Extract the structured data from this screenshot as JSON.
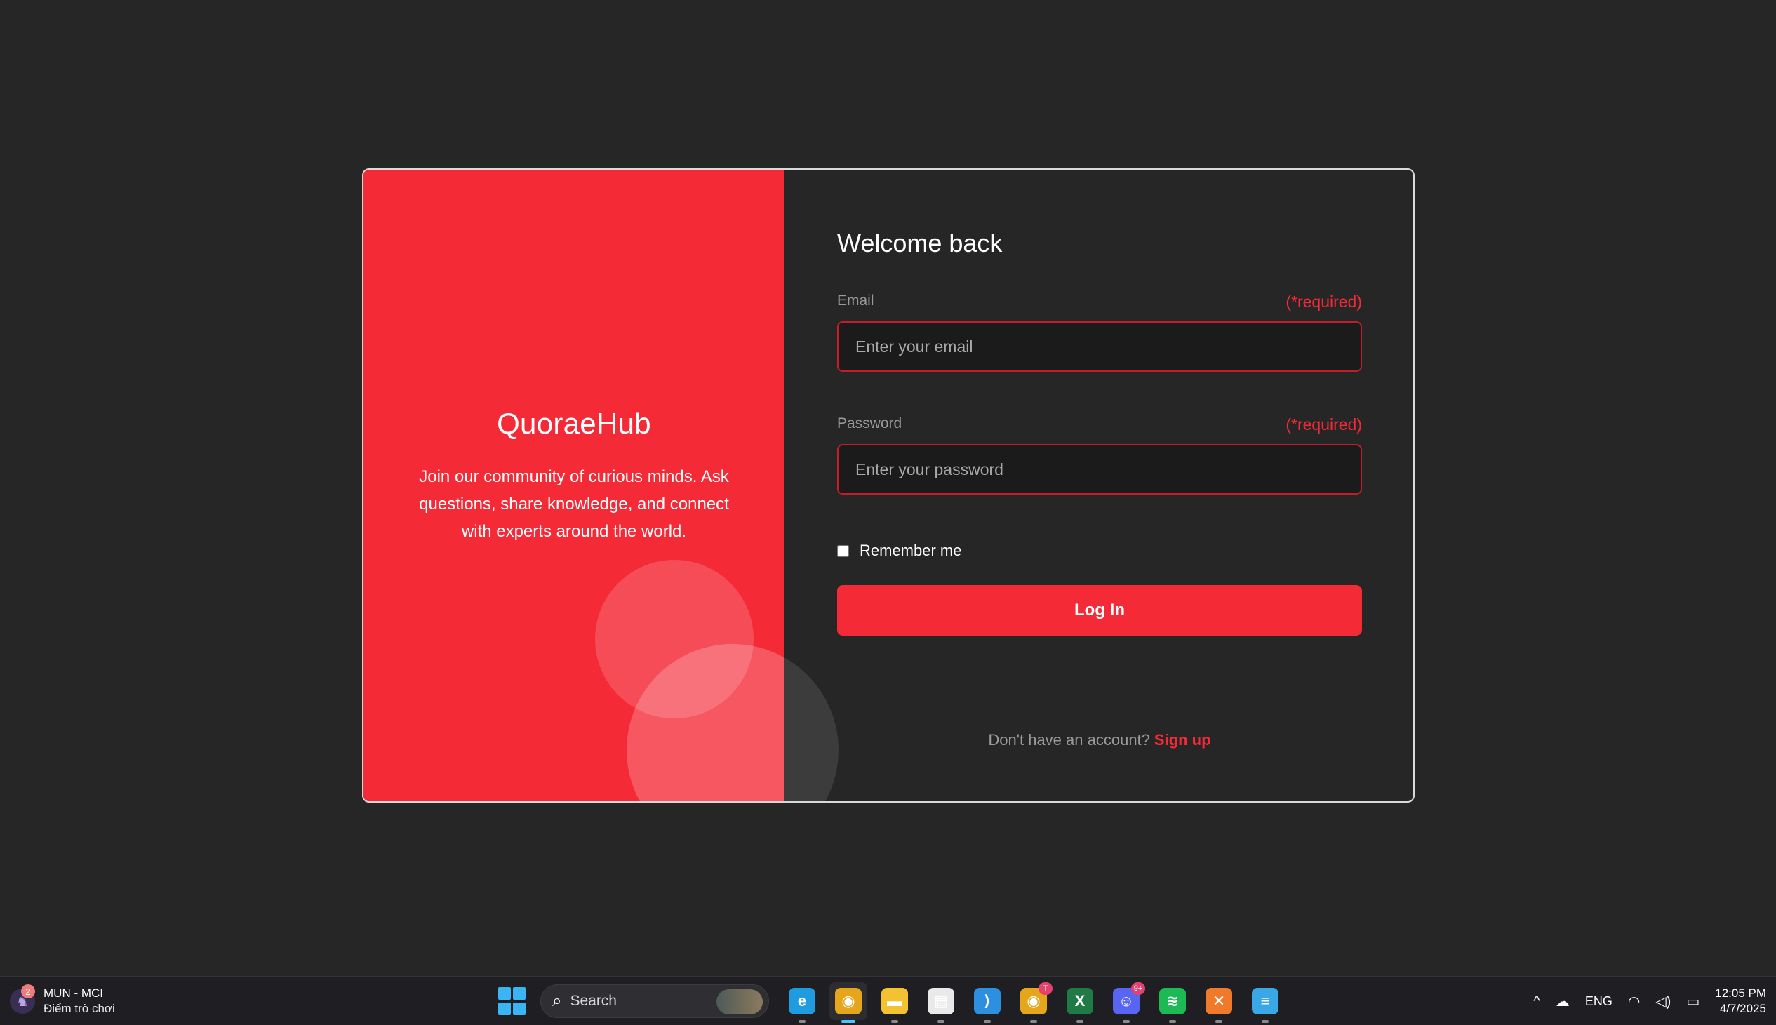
{
  "brand": {
    "title": "QuoraeHub",
    "description": "Join our community of curious minds. Ask questions, share knowledge, and connect with experts around the world.",
    "accent_color": "#f42a37"
  },
  "form": {
    "heading": "Welcome back",
    "email": {
      "label": "Email",
      "required_text": "(*required)",
      "placeholder": "Enter your email",
      "value": ""
    },
    "password": {
      "label": "Password",
      "required_text": "(*required)",
      "placeholder": "Enter your password",
      "value": ""
    },
    "remember_label": "Remember me",
    "remember_checked": false,
    "login_label": "Log In",
    "signup_prompt": "Don't have an account?",
    "signup_link": "Sign up"
  },
  "taskbar": {
    "game": {
      "badge": "2",
      "title": "MUN - MCI",
      "subtitle": "Điểm trò chơi"
    },
    "search_label": "Search",
    "apps": [
      {
        "name": "edge-icon",
        "label": "e",
        "color": "#1f9be0"
      },
      {
        "name": "chrome-icon",
        "label": "◉",
        "color": "#e5a61b",
        "active": true
      },
      {
        "name": "file-explorer-icon",
        "label": "▬",
        "color": "#f2c230"
      },
      {
        "name": "store-icon",
        "label": "▦",
        "color": "#e9e9e9"
      },
      {
        "name": "vscode-icon",
        "label": "⟩",
        "color": "#2d8fe0"
      },
      {
        "name": "chrome-profile-icon",
        "label": "◉",
        "color": "#e5a61b",
        "badge": "T"
      },
      {
        "name": "excel-icon",
        "label": "X",
        "color": "#1f7a45"
      },
      {
        "name": "discord-icon",
        "label": "☺",
        "color": "#5865f2",
        "badge": "9+"
      },
      {
        "name": "spotify-icon",
        "label": "≋",
        "color": "#1db954"
      },
      {
        "name": "xampp-icon",
        "label": "✕",
        "color": "#f07a2a"
      },
      {
        "name": "notepad-icon",
        "label": "≡",
        "color": "#3aa7e6"
      }
    ],
    "tray": {
      "chevron": "^",
      "cloud": "☁",
      "language": "ENG",
      "wifi": "◠",
      "volume": "◁)",
      "battery": "▭"
    },
    "clock": {
      "time": "12:05 PM",
      "date": "4/7/2025"
    }
  }
}
